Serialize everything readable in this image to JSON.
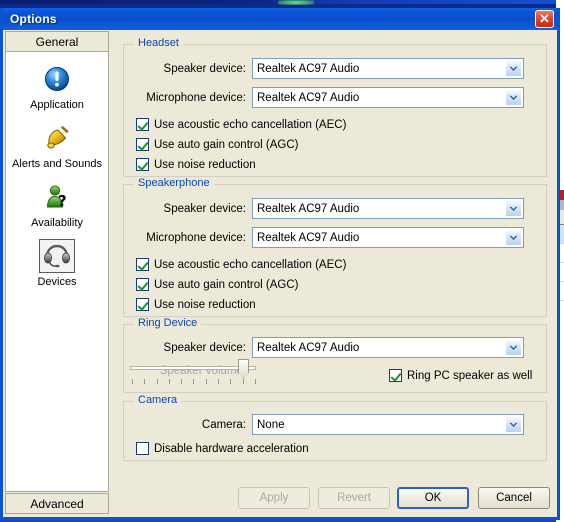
{
  "window": {
    "title": "Options",
    "close_label": "✕"
  },
  "sidebar": {
    "header_tab": "General",
    "footer_tab": "Advanced",
    "items": [
      {
        "label": "Application",
        "icon": "info-exclamation-icon",
        "selected": false
      },
      {
        "label": "Alerts and Sounds",
        "icon": "bell-icon",
        "selected": false
      },
      {
        "label": "Availability",
        "icon": "availability-person-question-icon",
        "selected": false
      },
      {
        "label": "Devices",
        "icon": "headset-icon",
        "selected": true
      }
    ]
  },
  "groups": {
    "headset": {
      "title": "Headset",
      "speaker_label": "Speaker device:",
      "speaker_value": "Realtek AC97 Audio",
      "microphone_label": "Microphone device:",
      "microphone_value": "Realtek AC97 Audio",
      "checkboxes": [
        {
          "label": "Use acoustic echo cancellation (AEC)",
          "checked": true
        },
        {
          "label": "Use auto gain control (AGC)",
          "checked": true
        },
        {
          "label": "Use noise reduction",
          "checked": true
        }
      ]
    },
    "speakerphone": {
      "title": "Speakerphone",
      "speaker_label": "Speaker device:",
      "speaker_value": "Realtek AC97 Audio",
      "microphone_label": "Microphone device:",
      "microphone_value": "Realtek AC97 Audio",
      "checkboxes": [
        {
          "label": "Use acoustic echo cancellation (AEC)",
          "checked": true
        },
        {
          "label": "Use auto gain control (AGC)",
          "checked": true
        },
        {
          "label": "Use noise reduction",
          "checked": true
        }
      ]
    },
    "ring_device": {
      "title": "Ring Device",
      "speaker_label": "Speaker device:",
      "speaker_value": "Realtek AC97 Audio",
      "volume_label": "Speaker volume:",
      "volume_disabled": true,
      "volume_percent": 87,
      "volume_ticks": 11,
      "ring_pc_label": "Ring PC speaker as well",
      "ring_pc_checked": true
    },
    "camera": {
      "title": "Camera",
      "camera_label": "Camera:",
      "camera_value": "None",
      "disable_hw_label": "Disable hardware acceleration",
      "disable_hw_checked": false
    }
  },
  "footer": {
    "apply": "Apply",
    "revert": "Revert",
    "ok": "OK",
    "cancel": "Cancel",
    "apply_enabled": false,
    "revert_enabled": false
  },
  "colors": {
    "titlebar_blue": "#0a56d6",
    "group_title_blue": "#0a46b4",
    "dialog_face": "#ece9d8",
    "check_green": "#1a8f2a",
    "close_red": "#c22a12"
  }
}
